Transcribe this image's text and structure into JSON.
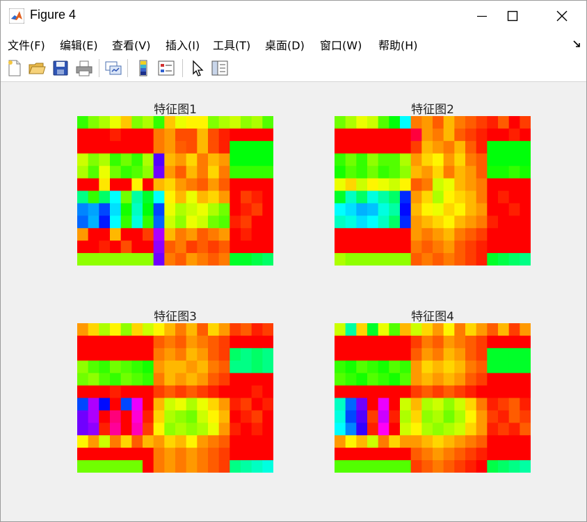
{
  "window": {
    "title": "Figure 4",
    "controls": [
      "minimize",
      "maximize",
      "close"
    ]
  },
  "menubar": {
    "items": [
      "文件(F)",
      "编辑(E)",
      "查看(V)",
      "插入(I)",
      "工具(T)",
      "桌面(D)",
      "窗口(W)",
      "帮助(H)"
    ]
  },
  "toolbar": {
    "icons": [
      "new-figure-icon",
      "open-file-icon",
      "save-icon",
      "print-icon",
      "link-plot-icon",
      "insert-colorbar-icon",
      "insert-legend-icon",
      "edit-plot-pointer-icon",
      "property-inspector-icon"
    ]
  },
  "colors": {
    "window_bg": "#f0f0f0",
    "titlebar_bg": "#ffffff",
    "accent_red": "#ff1a0d",
    "accent_orange": "#ff6a00",
    "accent_green": "#33ff33"
  },
  "chart_data": [
    {
      "type": "heatmap",
      "title": "特征图1",
      "rows": 12,
      "cols": 18,
      "colormap": "hsv",
      "grid": false,
      "values": [
        [
          0.3,
          0.25,
          0.22,
          0.18,
          0.13,
          0.25,
          0.22,
          0.3,
          0.13,
          0.18,
          0.16,
          0.16,
          0.25,
          0.22,
          0.2,
          0.24,
          0.22,
          0.28
        ],
        [
          0.0,
          0.0,
          0.0,
          0.02,
          0.0,
          0.0,
          0.0,
          0.08,
          0.1,
          0.05,
          0.05,
          0.12,
          0.05,
          0.02,
          0.0,
          0.0,
          0.0,
          0.0
        ],
        [
          0.0,
          0.0,
          0.0,
          0.0,
          0.0,
          0.0,
          0.0,
          0.08,
          0.1,
          0.06,
          0.05,
          0.12,
          0.05,
          0.02,
          0.34,
          0.34,
          0.34,
          0.34
        ],
        [
          0.2,
          0.25,
          0.22,
          0.3,
          0.26,
          0.3,
          0.22,
          0.72,
          0.12,
          0.1,
          0.14,
          0.08,
          0.12,
          0.1,
          0.34,
          0.34,
          0.34,
          0.34
        ],
        [
          0.22,
          0.28,
          0.18,
          0.26,
          0.3,
          0.28,
          0.24,
          0.74,
          0.1,
          0.06,
          0.12,
          0.08,
          0.14,
          0.08,
          0.3,
          0.3,
          0.3,
          0.3
        ],
        [
          0.0,
          0.0,
          0.15,
          0.0,
          0.0,
          0.16,
          0.0,
          0.12,
          0.14,
          0.1,
          0.08,
          0.06,
          0.1,
          0.06,
          0.0,
          0.0,
          0.0,
          0.0
        ],
        [
          0.42,
          0.3,
          0.4,
          0.5,
          0.26,
          0.44,
          0.36,
          0.5,
          0.16,
          0.12,
          0.18,
          0.12,
          0.14,
          0.1,
          0.0,
          0.04,
          0.02,
          0.0
        ],
        [
          0.58,
          0.56,
          0.62,
          0.52,
          0.32,
          0.46,
          0.34,
          0.62,
          0.18,
          0.22,
          0.2,
          0.18,
          0.22,
          0.26,
          0.0,
          0.02,
          0.04,
          0.0
        ],
        [
          0.6,
          0.55,
          0.65,
          0.5,
          0.3,
          0.48,
          0.3,
          0.6,
          0.2,
          0.24,
          0.18,
          0.2,
          0.26,
          0.28,
          0.02,
          0.04,
          0.0,
          0.0
        ],
        [
          0.1,
          0.0,
          0.0,
          0.12,
          0.0,
          0.0,
          0.04,
          0.78,
          0.12,
          0.08,
          0.1,
          0.06,
          0.08,
          0.1,
          0.0,
          0.02,
          0.0,
          0.0
        ],
        [
          0.0,
          0.0,
          0.02,
          0.0,
          0.05,
          0.0,
          0.0,
          0.76,
          0.06,
          0.08,
          0.04,
          0.06,
          0.04,
          0.06,
          0.0,
          0.0,
          0.0,
          0.0
        ],
        [
          0.24,
          0.24,
          0.24,
          0.24,
          0.24,
          0.24,
          0.24,
          0.74,
          0.08,
          0.06,
          0.1,
          0.08,
          0.06,
          0.08,
          0.36,
          0.36,
          0.38,
          0.4
        ]
      ]
    },
    {
      "type": "heatmap",
      "title": "特征图2",
      "rows": 12,
      "cols": 18,
      "colormap": "hsv",
      "grid": false,
      "values": [
        [
          0.26,
          0.22,
          0.18,
          0.2,
          0.28,
          0.34,
          0.5,
          0.08,
          0.1,
          0.06,
          0.12,
          0.08,
          0.06,
          0.04,
          0.02,
          0.06,
          0.0,
          0.04
        ],
        [
          0.0,
          0.0,
          0.0,
          0.0,
          0.0,
          0.0,
          0.0,
          0.96,
          0.1,
          0.08,
          0.12,
          0.06,
          0.04,
          0.02,
          0.0,
          0.0,
          0.02,
          0.0
        ],
        [
          0.0,
          0.0,
          0.0,
          0.0,
          0.0,
          0.0,
          0.0,
          0.04,
          0.12,
          0.1,
          0.08,
          0.12,
          0.06,
          0.02,
          0.34,
          0.34,
          0.34,
          0.34
        ],
        [
          0.3,
          0.26,
          0.3,
          0.24,
          0.28,
          0.28,
          0.22,
          0.1,
          0.14,
          0.16,
          0.1,
          0.14,
          0.08,
          0.06,
          0.34,
          0.34,
          0.34,
          0.34
        ],
        [
          0.32,
          0.28,
          0.3,
          0.26,
          0.3,
          0.28,
          0.24,
          0.12,
          0.1,
          0.14,
          0.08,
          0.12,
          0.1,
          0.06,
          0.32,
          0.32,
          0.3,
          0.32
        ],
        [
          0.18,
          0.14,
          0.2,
          0.16,
          0.18,
          0.2,
          0.16,
          0.06,
          0.08,
          0.2,
          0.18,
          0.12,
          0.1,
          0.08,
          0.0,
          0.0,
          0.0,
          0.0
        ],
        [
          0.36,
          0.46,
          0.4,
          0.48,
          0.44,
          0.4,
          0.64,
          0.1,
          0.14,
          0.22,
          0.16,
          0.14,
          0.12,
          0.08,
          0.0,
          0.02,
          0.0,
          0.0
        ],
        [
          0.5,
          0.52,
          0.55,
          0.54,
          0.48,
          0.44,
          0.66,
          0.12,
          0.16,
          0.18,
          0.14,
          0.16,
          0.12,
          0.1,
          0.0,
          0.0,
          0.02,
          0.0
        ],
        [
          0.46,
          0.48,
          0.52,
          0.5,
          0.46,
          0.4,
          0.64,
          0.1,
          0.12,
          0.14,
          0.16,
          0.12,
          0.1,
          0.08,
          0.02,
          0.0,
          0.0,
          0.0
        ],
        [
          0.0,
          0.0,
          0.0,
          0.0,
          0.0,
          0.0,
          0.0,
          0.1,
          0.08,
          0.1,
          0.12,
          0.08,
          0.06,
          0.04,
          0.0,
          0.0,
          0.0,
          0.0
        ],
        [
          0.0,
          0.0,
          0.0,
          0.0,
          0.0,
          0.0,
          0.0,
          0.08,
          0.06,
          0.08,
          0.1,
          0.06,
          0.04,
          0.02,
          0.0,
          0.0,
          0.0,
          0.0
        ],
        [
          0.22,
          0.24,
          0.24,
          0.24,
          0.24,
          0.24,
          0.24,
          0.06,
          0.08,
          0.06,
          0.08,
          0.06,
          0.04,
          0.02,
          0.36,
          0.38,
          0.4,
          0.42
        ]
      ]
    },
    {
      "type": "heatmap",
      "title": "特征图3",
      "rows": 12,
      "cols": 18,
      "colormap": "hsv",
      "grid": false,
      "values": [
        [
          0.1,
          0.14,
          0.22,
          0.16,
          0.24,
          0.14,
          0.2,
          0.16,
          0.12,
          0.08,
          0.12,
          0.06,
          0.14,
          0.1,
          0.04,
          0.06,
          0.02,
          0.04
        ],
        [
          0.0,
          0.0,
          0.0,
          0.0,
          0.0,
          0.0,
          0.0,
          0.06,
          0.08,
          0.06,
          0.1,
          0.08,
          0.06,
          0.04,
          0.0,
          0.0,
          0.0,
          0.0
        ],
        [
          0.0,
          0.0,
          0.0,
          0.0,
          0.0,
          0.0,
          0.0,
          0.08,
          0.1,
          0.08,
          0.12,
          0.1,
          0.06,
          0.04,
          0.4,
          0.42,
          0.4,
          0.42
        ],
        [
          0.24,
          0.28,
          0.3,
          0.26,
          0.28,
          0.3,
          0.32,
          0.1,
          0.12,
          0.12,
          0.1,
          0.12,
          0.08,
          0.06,
          0.42,
          0.42,
          0.4,
          0.42
        ],
        [
          0.26,
          0.24,
          0.28,
          0.3,
          0.26,
          0.28,
          0.3,
          0.08,
          0.12,
          0.1,
          0.12,
          0.1,
          0.06,
          0.04,
          0.0,
          0.0,
          0.0,
          0.0
        ],
        [
          0.0,
          0.0,
          0.0,
          0.02,
          0.0,
          0.0,
          0.0,
          0.04,
          0.06,
          0.04,
          0.06,
          0.04,
          0.02,
          0.0,
          0.0,
          0.0,
          0.02,
          0.0
        ],
        [
          0.62,
          0.78,
          0.66,
          0.0,
          0.62,
          0.82,
          0.0,
          0.12,
          0.2,
          0.18,
          0.22,
          0.18,
          0.14,
          0.1,
          0.02,
          0.04,
          0.0,
          0.02
        ],
        [
          0.74,
          0.78,
          0.0,
          0.92,
          0.0,
          0.86,
          0.02,
          0.14,
          0.22,
          0.24,
          0.26,
          0.2,
          0.16,
          0.12,
          0.0,
          0.02,
          0.04,
          0.0
        ],
        [
          0.74,
          0.76,
          0.02,
          0.9,
          0.0,
          0.88,
          0.04,
          0.16,
          0.24,
          0.22,
          0.24,
          0.22,
          0.18,
          0.1,
          0.02,
          0.0,
          0.02,
          0.0
        ],
        [
          0.16,
          0.1,
          0.2,
          0.08,
          0.14,
          0.06,
          0.12,
          0.1,
          0.14,
          0.12,
          0.16,
          0.1,
          0.08,
          0.06,
          0.0,
          0.0,
          0.0,
          0.0
        ],
        [
          0.0,
          0.0,
          0.0,
          0.0,
          0.0,
          0.0,
          0.0,
          0.08,
          0.1,
          0.08,
          0.1,
          0.08,
          0.06,
          0.04,
          0.0,
          0.0,
          0.0,
          0.0
        ],
        [
          0.26,
          0.26,
          0.26,
          0.26,
          0.26,
          0.26,
          0.0,
          0.08,
          0.1,
          0.08,
          0.1,
          0.08,
          0.06,
          0.04,
          0.42,
          0.44,
          0.46,
          0.48
        ]
      ]
    },
    {
      "type": "heatmap",
      "title": "特征图4",
      "rows": 12,
      "cols": 18,
      "colormap": "hsv",
      "grid": false,
      "values": [
        [
          0.2,
          0.44,
          0.14,
          0.36,
          0.18,
          0.28,
          0.12,
          0.2,
          0.14,
          0.1,
          0.16,
          0.08,
          0.14,
          0.1,
          0.06,
          0.12,
          0.04,
          0.1
        ],
        [
          0.0,
          0.0,
          0.0,
          0.0,
          0.0,
          0.0,
          0.0,
          0.04,
          0.08,
          0.06,
          0.1,
          0.08,
          0.06,
          0.04,
          0.0,
          0.0,
          0.0,
          0.0
        ],
        [
          0.0,
          0.0,
          0.0,
          0.0,
          0.0,
          0.0,
          0.0,
          0.06,
          0.1,
          0.08,
          0.12,
          0.1,
          0.06,
          0.04,
          0.36,
          0.36,
          0.36,
          0.36
        ],
        [
          0.3,
          0.32,
          0.28,
          0.3,
          0.32,
          0.28,
          0.3,
          0.1,
          0.14,
          0.12,
          0.14,
          0.12,
          0.08,
          0.06,
          0.36,
          0.36,
          0.36,
          0.36
        ],
        [
          0.28,
          0.3,
          0.32,
          0.28,
          0.3,
          0.32,
          0.28,
          0.1,
          0.12,
          0.1,
          0.12,
          0.1,
          0.06,
          0.04,
          0.0,
          0.0,
          0.0,
          0.0
        ],
        [
          0.0,
          0.0,
          0.0,
          0.0,
          0.0,
          0.0,
          0.0,
          0.04,
          0.06,
          0.04,
          0.06,
          0.04,
          0.02,
          0.0,
          0.0,
          0.0,
          0.0,
          0.0
        ],
        [
          0.46,
          0.6,
          0.74,
          0.0,
          0.82,
          0.0,
          0.2,
          0.12,
          0.22,
          0.2,
          0.24,
          0.2,
          0.14,
          0.08,
          0.02,
          0.04,
          0.06,
          0.02
        ],
        [
          0.48,
          0.62,
          0.72,
          0.04,
          0.8,
          0.02,
          0.22,
          0.14,
          0.24,
          0.22,
          0.26,
          0.22,
          0.16,
          0.1,
          0.04,
          0.02,
          0.06,
          0.04
        ],
        [
          0.5,
          0.58,
          0.7,
          0.02,
          0.84,
          0.0,
          0.2,
          0.16,
          0.22,
          0.24,
          0.22,
          0.2,
          0.14,
          0.1,
          0.02,
          0.04,
          0.02,
          0.06
        ],
        [
          0.1,
          0.16,
          0.12,
          0.2,
          0.08,
          0.14,
          0.1,
          0.1,
          0.12,
          0.14,
          0.12,
          0.1,
          0.08,
          0.06,
          0.0,
          0.0,
          0.0,
          0.0
        ],
        [
          0.0,
          0.0,
          0.0,
          0.0,
          0.0,
          0.0,
          0.0,
          0.06,
          0.08,
          0.1,
          0.08,
          0.06,
          0.04,
          0.02,
          0.0,
          0.0,
          0.0,
          0.0
        ],
        [
          0.28,
          0.28,
          0.28,
          0.28,
          0.28,
          0.28,
          0.28,
          0.04,
          0.06,
          0.08,
          0.06,
          0.04,
          0.02,
          0.0,
          0.38,
          0.4,
          0.42,
          0.44
        ]
      ]
    }
  ]
}
